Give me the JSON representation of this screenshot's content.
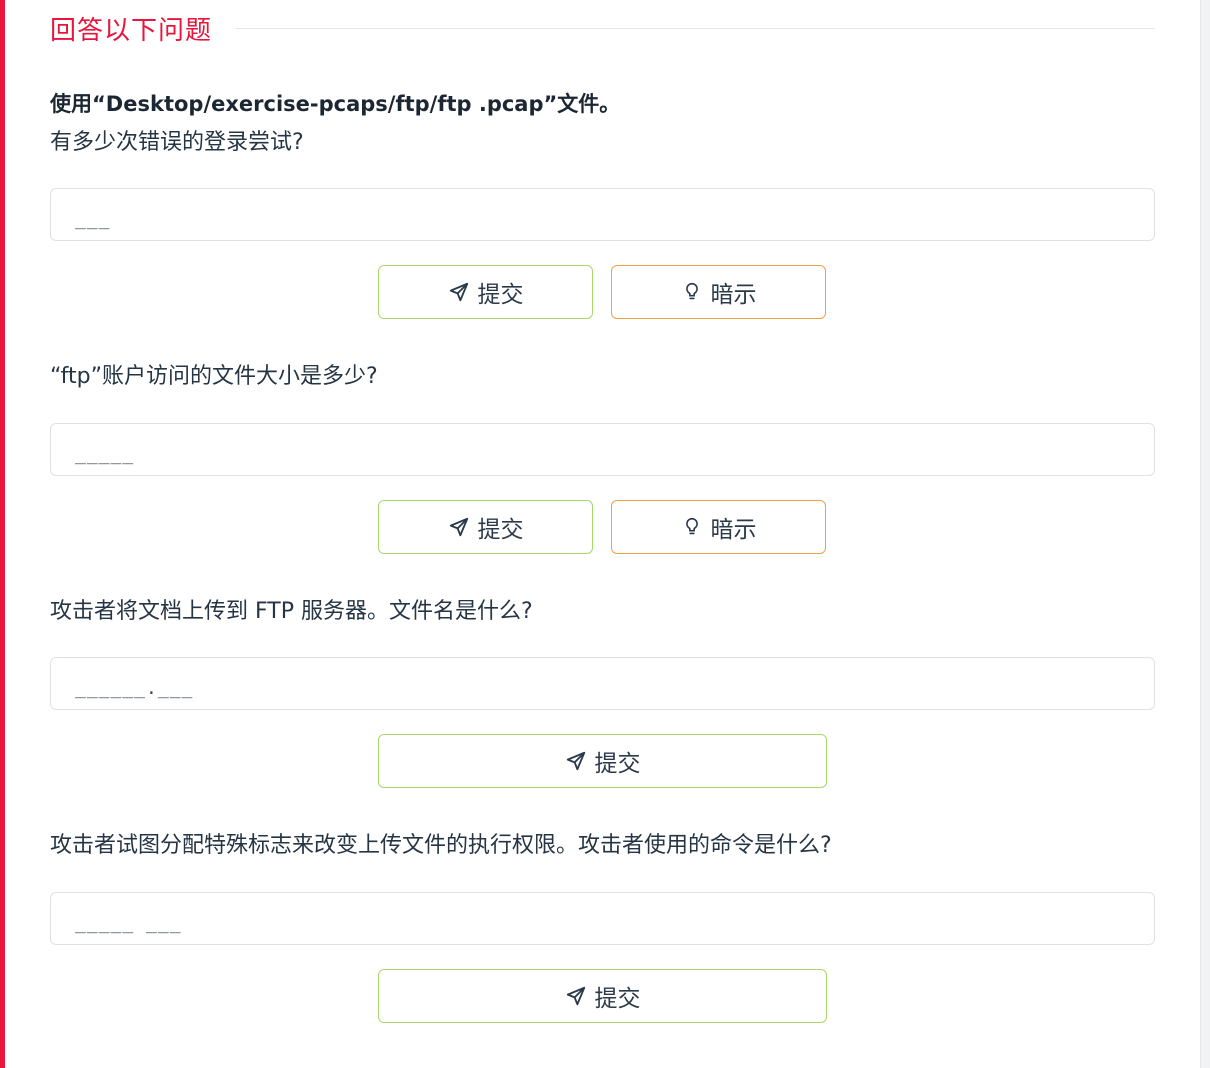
{
  "section": {
    "title": "回答以下问题"
  },
  "intro": "使用“Desktop/exercise-pcaps/ftp/ftp .pcap”文件。",
  "questions": [
    {
      "text": "有多少次错误的登录尝试?",
      "answer_mask": "___",
      "submit_label": "提交",
      "hint_label": "暗示"
    },
    {
      "text": "“ftp”账户访问的文件大小是多少?",
      "answer_mask": "_____",
      "submit_label": "提交",
      "hint_label": "暗示"
    },
    {
      "text": "攻击者将文档上传到 FTP 服务器。文件名是什么?",
      "answer_mask": "______.___",
      "submit_label": "提交"
    },
    {
      "text": "攻击者试图分配特殊标志来改变上传文件的执行权限。攻击者使用的命令是什么?",
      "answer_mask": "_____ ___",
      "submit_label": "提交"
    }
  ],
  "icons": {
    "submit": "paper-plane-icon",
    "hint": "lightbulb-icon"
  },
  "colors": {
    "accent": "#e8163c",
    "submit_border": "#a6d96a",
    "hint_border": "#f0a046"
  }
}
